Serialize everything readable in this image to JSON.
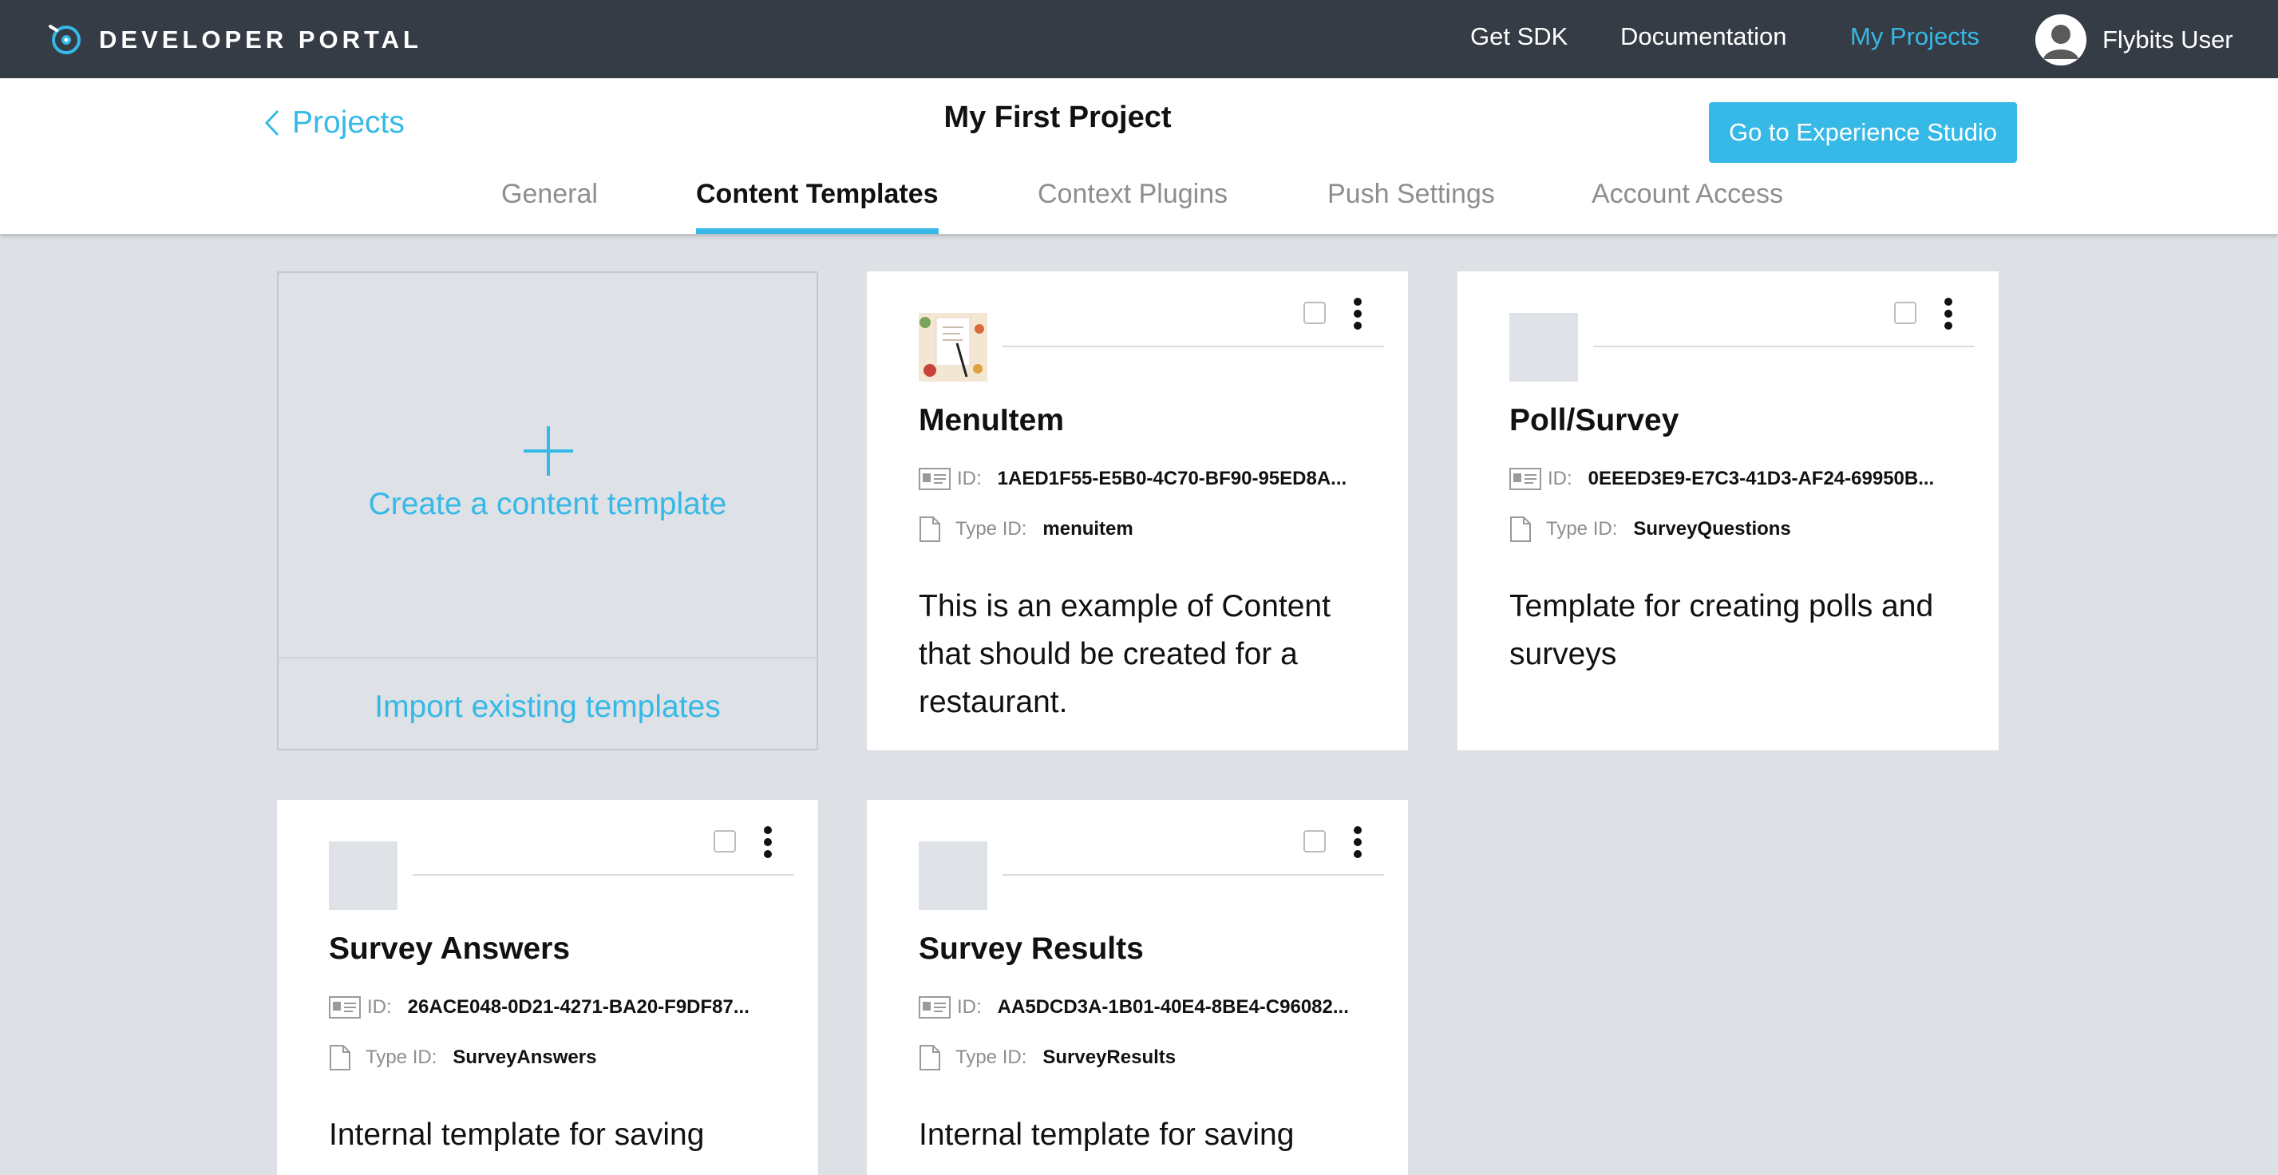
{
  "header": {
    "logo_text": "DEVELOPER PORTAL",
    "nav": [
      {
        "label": "Get SDK",
        "active": false
      },
      {
        "label": "Documentation",
        "active": false
      },
      {
        "label": "My Projects",
        "active": true
      }
    ],
    "user_name": "Flybits User"
  },
  "project": {
    "back_label": "Projects",
    "title": "My First Project",
    "studio_button": "Go to Experience Studio",
    "tabs": [
      {
        "label": "General",
        "active": false
      },
      {
        "label": "Content Templates",
        "active": true
      },
      {
        "label": "Context Plugins",
        "active": false
      },
      {
        "label": "Push Settings",
        "active": false
      },
      {
        "label": "Account Access",
        "active": false
      }
    ]
  },
  "create_card": {
    "create_label": "Create a content template",
    "import_label": "Import existing templates"
  },
  "labels": {
    "id": "ID:",
    "type_id": "Type ID:"
  },
  "templates": [
    {
      "name": "MenuItem",
      "id": "1AED1F55-E5B0-4C70-BF90-95ED8A...",
      "type_id": "menuitem",
      "description": "This is an example of Content that should be created for a restaurant.",
      "has_image": true
    },
    {
      "name": "Poll/Survey",
      "id": "0EEED3E9-E7C3-41D3-AF24-69950B...",
      "type_id": "SurveyQuestions",
      "description": "Template for creating polls and surveys",
      "has_image": false
    },
    {
      "name": "Survey Answers",
      "id": "26ACE048-0D21-4271-BA20-F9DF87...",
      "type_id": "SurveyAnswers",
      "description": "Internal template for saving survey",
      "has_image": false
    },
    {
      "name": "Survey Results",
      "id": "AA5DCD3A-1B01-40E4-8BE4-C96082...",
      "type_id": "SurveyResults",
      "description": "Internal template for saving survey",
      "has_image": false
    }
  ],
  "colors": {
    "accent": "#36b9e6",
    "topbar": "#353c45",
    "background": "#dde1e6"
  }
}
